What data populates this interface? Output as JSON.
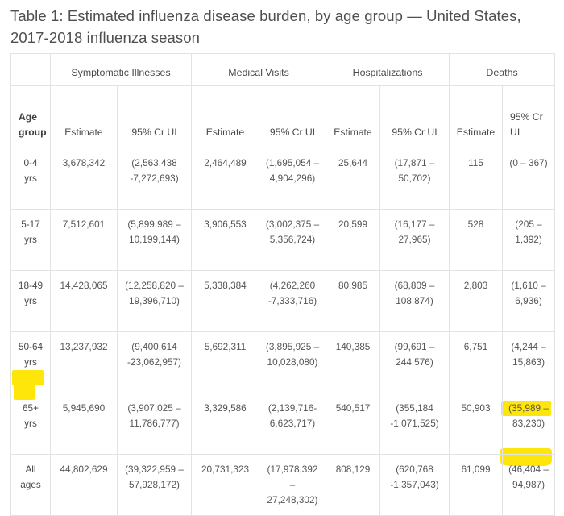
{
  "title": "Table 1: Estimated influenza disease burden, by age group — United States, 2017-2018 influenza season",
  "table": {
    "group_headers": {
      "corner": "",
      "symptomatic_illnesses": "Symptomatic Illnesses",
      "medical_visits": "Medical Visits",
      "hospitalizations": "Hospitalizations",
      "deaths": "Deaths"
    },
    "sub_headers": {
      "age_group": "Age group",
      "estimate_1": "Estimate",
      "cr_ui_1": "95% Cr UI",
      "estimate_2": "Estimate",
      "cr_ui_2": "95% Cr UI",
      "estimate_3": "Estimate",
      "cr_ui_3": "95% Cr UI",
      "estimate_4": "Estimate",
      "cr_ui_4": "95% Cr UI"
    },
    "rows": [
      {
        "age_group": "0-4 yrs",
        "si_estimate": "3,678,342",
        "si_crui": "(2,563,438 -7,272,693)",
        "mv_estimate": "2,464,489",
        "mv_crui": "(1,695,054 – 4,904,296)",
        "hosp_estimate": "25,644",
        "hosp_crui": "(17,871 – 50,702)",
        "death_estimate": "115",
        "death_crui": "(0 – 367)"
      },
      {
        "age_group": "5-17 yrs",
        "si_estimate": "7,512,601",
        "si_crui": "(5,899,989 – 10,199,144)",
        "mv_estimate": "3,906,553",
        "mv_crui": "(3,002,375 – 5,356,724)",
        "hosp_estimate": "20,599",
        "hosp_crui": "(16,177 – 27,965)",
        "death_estimate": "528",
        "death_crui": "(205 – 1,392)"
      },
      {
        "age_group": "18-49 yrs",
        "si_estimate": "14,428,065",
        "si_crui": "(12,258,820 – 19,396,710)",
        "mv_estimate": "5,338,384",
        "mv_crui": "(4,262,260 -7,333,716)",
        "hosp_estimate": "80,985",
        "hosp_crui": "(68,809 – 108,874)",
        "death_estimate": "2,803",
        "death_crui": "(1,610 – 6,936)"
      },
      {
        "age_group": "50-64 yrs",
        "si_estimate": "13,237,932",
        "si_crui": "(9,400,614 -23,062,957)",
        "mv_estimate": "5,692,311",
        "mv_crui": "(3,895,925 – 10,028,080)",
        "hosp_estimate": "140,385",
        "hosp_crui": "(99,691 – 244,576)",
        "death_estimate": "6,751",
        "death_crui": "(4,244 – 15,863)"
      },
      {
        "age_group": "65+ yrs",
        "si_estimate": "5,945,690",
        "si_crui": "(3,907,025 – 11,786,777)",
        "mv_estimate": "3,329,586",
        "mv_crui": "(2,139,716-6,623,717)",
        "hosp_estimate": "540,517",
        "hosp_crui": "(355,184 -1,071,525)",
        "death_estimate": "50,903",
        "death_crui": "(35,989 – 83,230)"
      },
      {
        "age_group": "All ages",
        "si_estimate": "44,802,629",
        "si_crui": "(39,322,959 – 57,928,172)",
        "mv_estimate": "20,731,323",
        "mv_crui": "(17,978,392 – 27,248,302)",
        "hosp_estimate": "808,129",
        "hosp_crui": "(620,768 -1,357,043)",
        "death_estimate": "61,099",
        "death_crui": "(46,404 – 94,987)"
      }
    ]
  },
  "highlights": {
    "color": "#ffe60a",
    "marked_texts": [
      "65+ yrs",
      "83,230)",
      "94,987)"
    ]
  }
}
